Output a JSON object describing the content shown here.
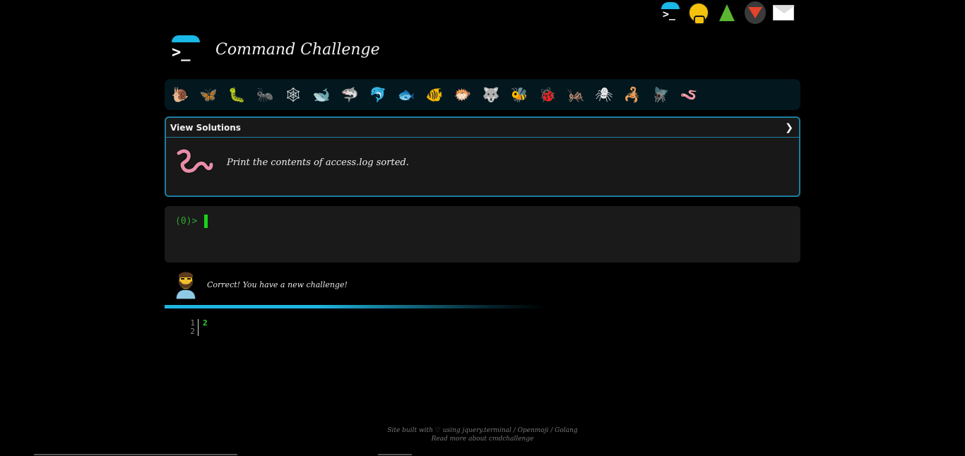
{
  "top_icons": [
    {
      "name": "command-challenge",
      "prompt": ">_"
    },
    {
      "name": "hushed-face"
    },
    {
      "name": "tree"
    },
    {
      "name": "gitlab"
    },
    {
      "name": "mail"
    }
  ],
  "header": {
    "logo_prompt": ">_",
    "title": "Command Challenge"
  },
  "animals": [
    {
      "icon": "snail-icon",
      "glyph": "🐌"
    },
    {
      "icon": "butterfly-icon",
      "glyph": "🦋"
    },
    {
      "icon": "caterpillar-icon",
      "glyph": "🐛"
    },
    {
      "icon": "ant-icon",
      "glyph": "🐜"
    },
    {
      "icon": "spider-web-icon",
      "glyph": "🕸"
    },
    {
      "icon": "whale-icon",
      "glyph": "🐋"
    },
    {
      "icon": "shark-icon",
      "glyph": "🦈"
    },
    {
      "icon": "dolphin-icon",
      "glyph": "🐬"
    },
    {
      "icon": "fish-icon",
      "glyph": "🐟"
    },
    {
      "icon": "tropical-fish-icon",
      "glyph": "🐠"
    },
    {
      "icon": "blowfish-icon",
      "glyph": "🐡"
    },
    {
      "icon": "wolf-icon",
      "glyph": "🐺"
    },
    {
      "icon": "bee-icon",
      "glyph": "🐝"
    },
    {
      "icon": "ladybug-icon",
      "glyph": "🐞"
    },
    {
      "icon": "cricket-icon",
      "glyph": "🦗"
    },
    {
      "icon": "spider-icon",
      "glyph": "🕷"
    },
    {
      "icon": "scorpion-icon",
      "glyph": "🦂"
    },
    {
      "icon": "fly-icon",
      "glyph": "🪰"
    },
    {
      "icon": "worm-icon",
      "glyph": "🪱"
    }
  ],
  "challenge": {
    "header_label": "View Solutions",
    "text": "Print the contents of access.log sorted."
  },
  "terminal": {
    "prompt": "(0)>"
  },
  "feedback": {
    "message": "Correct! You have a new challenge!"
  },
  "code_output": {
    "line_numbers": [
      "1",
      "2"
    ],
    "lines": [
      "2",
      ""
    ]
  },
  "footer": {
    "line1": "Site built with ♡ using jquery.terminal / Openmoji / Golang",
    "line2": "Read more about cmdchallenge"
  },
  "colors": {
    "accent": "#19b8e6",
    "card_border": "#1d7ea0",
    "terminal_green": "#2fa82f",
    "cursor": "#1ad31a"
  }
}
